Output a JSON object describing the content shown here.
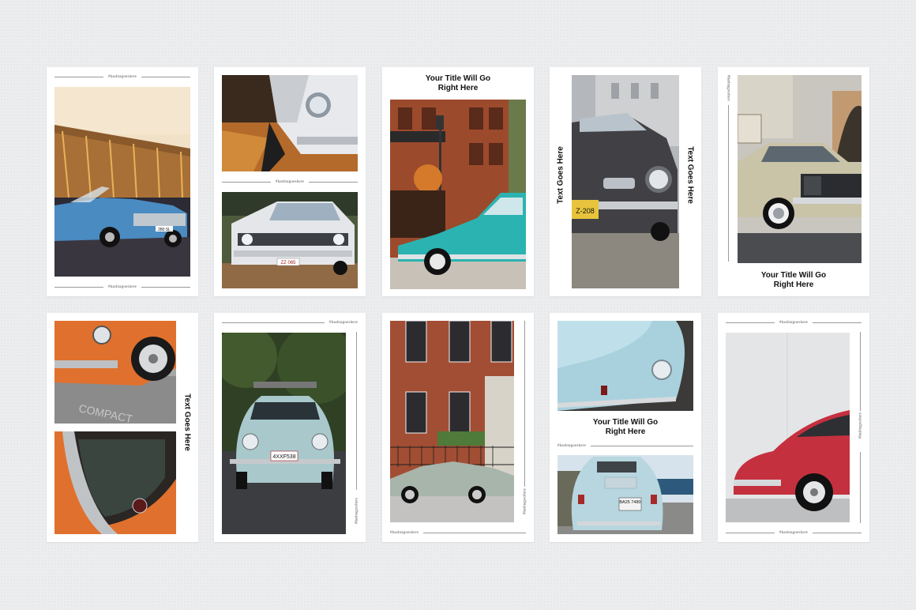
{
  "hashtag": "#hashtagoeshere",
  "title_line1": "Your Title Will Go",
  "title_line2": "Right Here",
  "vertical_text": "Text Goes Here",
  "plates": {
    "mercedes": "280 SL",
    "mustang": "ZZ 065",
    "karmann": "Z-208",
    "beetle": "4XXF538",
    "fiat": "BA25 7480"
  },
  "colors": {
    "background": "#ecedef",
    "card": "#ffffff",
    "teal_car": "#2bb3b1",
    "red_porsche": "#c5303f",
    "orange_porsche": "#e0702d"
  }
}
